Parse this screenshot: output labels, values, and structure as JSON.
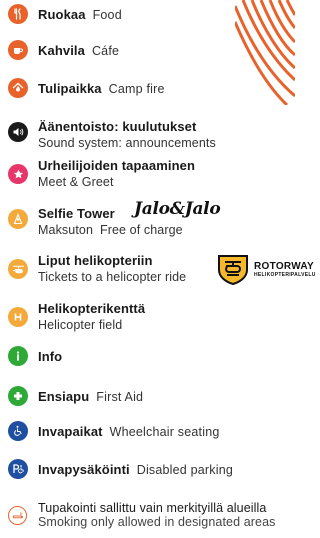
{
  "items": [
    {
      "fi": "Ruokaa",
      "en": "Food",
      "icon": "food-icon",
      "color": "#e8622c"
    },
    {
      "fi": "Kahvila",
      "en": "Cáfe",
      "icon": "coffee-icon",
      "color": "#e8622c"
    },
    {
      "fi": "Tulipaikka",
      "en": "Camp fire",
      "icon": "campfire-icon",
      "color": "#e8622c"
    },
    {
      "fi": "Äänentoisto: kuulutukset",
      "en": "Sound system: announcements",
      "icon": "speaker-icon",
      "color": "#1a1a1a"
    },
    {
      "fi": "Urheilijoiden tapaaminen",
      "en": "Meet & Greet",
      "icon": "star-icon",
      "color": "#e8356b"
    },
    {
      "fi": "Selfie Tower",
      "en_fi": "Maksuton",
      "en": "Free of charge",
      "icon": "camera-tower-icon",
      "color": "#f4a93b",
      "logo": "Jalo&Jalo"
    },
    {
      "fi": "Liput helikopteriin",
      "en": "Tickets to a helicopter ride",
      "icon": "helicopter-icon",
      "color": "#f4a93b",
      "logo": "ROTORWAY",
      "logo_sub": "HELIKOPTERIPALVELU"
    },
    {
      "fi": "Helikopterikenttä",
      "en": "Helicopter field",
      "icon": "helipad-icon",
      "color": "#f4a93b"
    },
    {
      "fi": "Info",
      "icon": "info-icon",
      "color": "#2ea836"
    },
    {
      "fi": "Ensiapu",
      "en": "First Aid",
      "icon": "first-aid-icon",
      "color": "#2ea836"
    },
    {
      "fi": "Invapaikat",
      "en": "Wheelchair seating",
      "icon": "wheelchair-icon",
      "color": "#1f4fa0"
    },
    {
      "fi": "Invapysäköinti",
      "en": "Disabled parking",
      "icon": "disabled-parking-icon",
      "color": "#1f4fa0"
    },
    {
      "fi": "Tupakointi sallittu vain merkityillä alueilla",
      "en": "Smoking only allowed in designated areas",
      "icon": "smoking-icon",
      "color": "#e8622c"
    }
  ],
  "colors": {
    "stripe": "#e8622c"
  }
}
